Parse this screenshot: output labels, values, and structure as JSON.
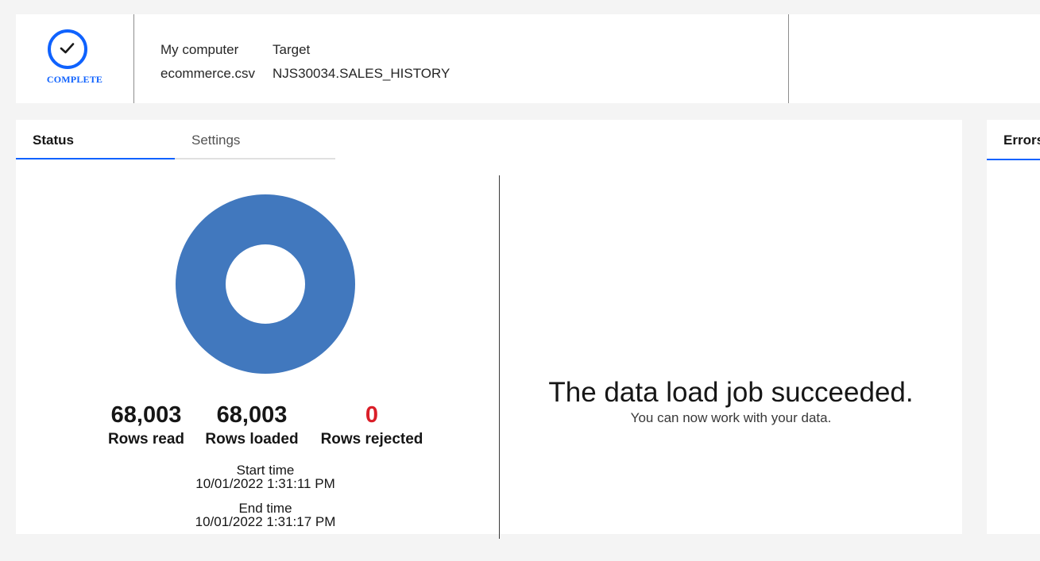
{
  "header": {
    "status_label": "COMPLETE",
    "source": {
      "label": "My computer",
      "value": "ecommerce.csv"
    },
    "target": {
      "label": "Target",
      "value": "NJS30034.SALES_HISTORY"
    }
  },
  "tabs": [
    {
      "label": "Status",
      "selected": true
    },
    {
      "label": "Settings",
      "selected": false
    }
  ],
  "chart_data": {
    "type": "pie",
    "categories": [
      "Rows loaded",
      "Rows rejected"
    ],
    "values": [
      68003,
      0
    ],
    "colors": [
      "#4178be",
      "#da1e28"
    ]
  },
  "stats": {
    "rows_read": {
      "value": "68,003",
      "label": "Rows read"
    },
    "rows_loaded": {
      "value": "68,003",
      "label": "Rows loaded"
    },
    "rows_rejected": {
      "value": "0",
      "label": "Rows rejected"
    }
  },
  "times": {
    "start_label": "Start time",
    "start_value": "10/01/2022 1:31:11 PM",
    "end_label": "End time",
    "end_value": "10/01/2022 1:31:17 PM"
  },
  "result": {
    "title": "The data load job succeeded.",
    "subtitle": "You can now work with your data."
  },
  "errors_panel": {
    "tab_label": "Errors"
  },
  "colors": {
    "accent": "#0f62fe",
    "donut": "#4178be",
    "error": "#da1e28",
    "background": "#f4f4f4"
  }
}
